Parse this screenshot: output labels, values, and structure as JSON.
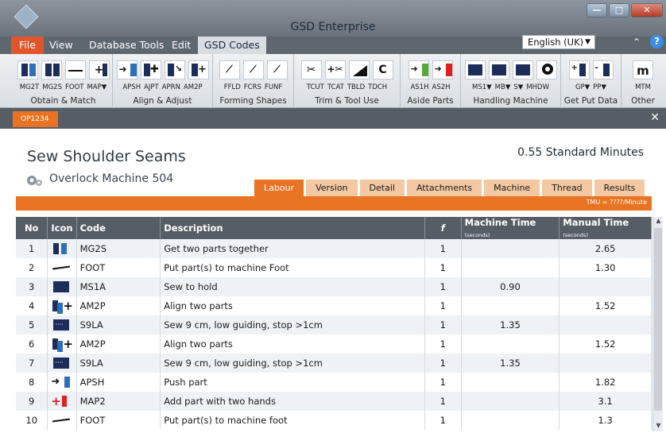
{
  "window": {
    "title": "GSD  Enterprise",
    "controls": [
      "—",
      "□",
      "✕"
    ]
  },
  "ribbon_tabs": [
    "File",
    "View",
    "Database Tools",
    "Edit",
    "GSD Codes"
  ],
  "language": {
    "selected": "English (UK)"
  },
  "help": {
    "label": "?"
  },
  "collapse": {
    "label": "⌃"
  },
  "groups": {
    "obtain": {
      "label": "Obtain & Match",
      "buttons": [
        "MG2T",
        "MG2S",
        "FOOT",
        "MAP▼"
      ]
    },
    "align": {
      "label": "Align & Adjust",
      "buttons": [
        "APSH",
        "AJPT",
        "APRN",
        "AM2P"
      ]
    },
    "forming": {
      "label": "Forming Shapes",
      "buttons": [
        "FFLD",
        "FCRS",
        "FUNF"
      ]
    },
    "trim": {
      "label": "Trim & Tool Use",
      "buttons": [
        "TCUT",
        "TCAT",
        "TBLD",
        "TDCH"
      ]
    },
    "aside": {
      "label": "Aside Parts",
      "buttons": [
        "AS1H",
        "AS2H"
      ]
    },
    "handling": {
      "label": "Handling Machine",
      "buttons": [
        "MS1▼",
        "MB▼",
        "S▼",
        "MHDW"
      ]
    },
    "getput": {
      "label": "Get Put Data",
      "buttons": [
        "GP▼",
        "PP▼"
      ]
    },
    "other": {
      "label": "Other",
      "buttons": [
        "MTM"
      ]
    }
  },
  "doc_tab": {
    "label": "OP1234",
    "close": "✕"
  },
  "operation": {
    "title": "Sew Shoulder Seams",
    "standard_minutes": "0.55 Standard Minutes",
    "machine": "Overlock Machine 504"
  },
  "subtabs": [
    "Labour",
    "Version",
    "Detail",
    "Attachments",
    "Machine",
    "Thread",
    "Results"
  ],
  "tmu_note": "TMU = ????/Minute",
  "table": {
    "headers": {
      "no": "No",
      "icon": "Icon",
      "code": "Code",
      "description": "Description",
      "f": "f",
      "machine_time": "Machine Time",
      "manual_time": "Manual Time",
      "unit": "(seconds)"
    },
    "rows": [
      {
        "no": "1",
        "icon": "mg2s-icon",
        "code": "MG2S",
        "description": "Get two parts together",
        "f": "1",
        "machine": "",
        "manual": "2.65"
      },
      {
        "no": "2",
        "icon": "foot-icon",
        "code": "FOOT",
        "description": "Put part(s) to machine Foot",
        "f": "1",
        "machine": "",
        "manual": "1.30"
      },
      {
        "no": "3",
        "icon": "ms1a-icon",
        "code": "MS1A",
        "description": "Sew to hold",
        "f": "1",
        "machine": "0.90",
        "manual": ""
      },
      {
        "no": "4",
        "icon": "am2p-icon",
        "code": "AM2P",
        "description": "Align two parts",
        "f": "1",
        "machine": "",
        "manual": "1.52"
      },
      {
        "no": "5",
        "icon": "s9la-icon",
        "code": "S9LA",
        "description": "Sew 9 cm, low guiding, stop >1cm",
        "f": "1",
        "machine": "1.35",
        "manual": ""
      },
      {
        "no": "6",
        "icon": "am2p-icon",
        "code": "AM2P",
        "description": "Align two parts",
        "f": "1",
        "machine": "",
        "manual": "1.52"
      },
      {
        "no": "7",
        "icon": "s9la-icon",
        "code": "S9LA",
        "description": "Sew 9 cm, low guiding, stop >1cm",
        "f": "1",
        "machine": "1.35",
        "manual": ""
      },
      {
        "no": "8",
        "icon": "apsh-icon",
        "code": "APSH",
        "description": "Push part",
        "f": "1",
        "machine": "",
        "manual": "1.82"
      },
      {
        "no": "9",
        "icon": "map2-icon",
        "code": "MAP2",
        "description": "Add part with two hands",
        "f": "1",
        "machine": "",
        "manual": "3.1"
      },
      {
        "no": "10",
        "icon": "foot-icon",
        "code": "FOOT",
        "description": "Put part(s) to machine foot",
        "f": "1",
        "machine": "",
        "manual": "1.3"
      }
    ]
  },
  "colors": {
    "accent": "#e87322",
    "file_tab": "#e0562a",
    "header_dark": "#565d64",
    "navy": "#1c2d59",
    "blue": "#2f6fb8",
    "red": "#e0201e",
    "green": "#56a83c"
  }
}
